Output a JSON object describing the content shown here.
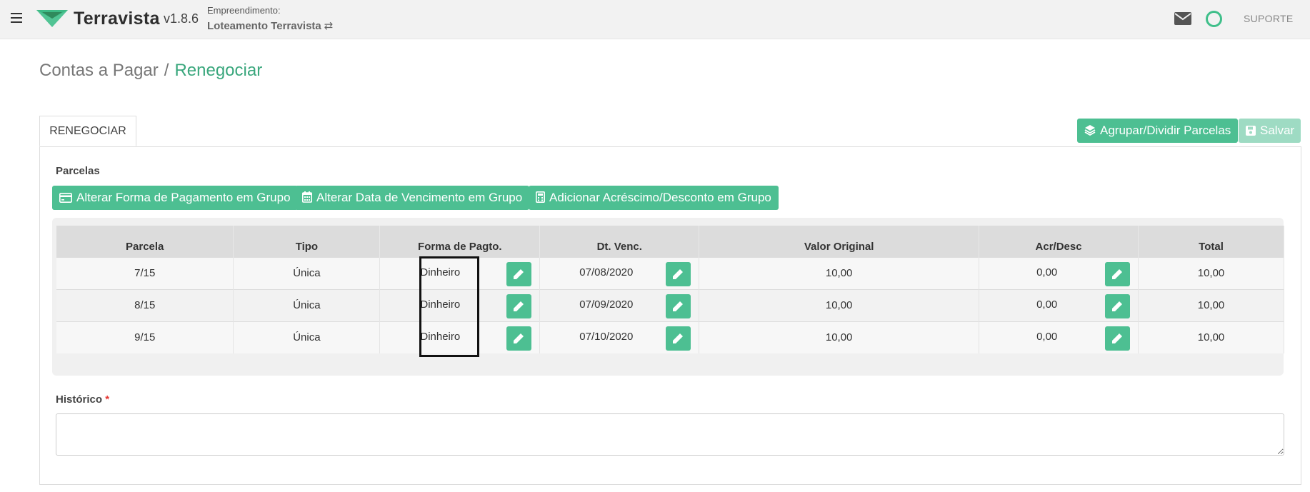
{
  "header": {
    "app_name": "Terravista",
    "version": "v1.8.6",
    "empreendimento_label": "Empreendimento:",
    "empreendimento_name": "Loteamento Terravista",
    "swap_symbol": "⇄",
    "support_label": "SUPORTE",
    "brand_color": "#3fbf8a"
  },
  "breadcrumb": {
    "parent": "Contas a Pagar",
    "separator": "/",
    "current": "Renegociar"
  },
  "tabs": [
    {
      "label": "RENEGOCIAR",
      "active": true
    }
  ],
  "actions": {
    "group_split": "Agrupar/Dividir Parcelas",
    "save": "Salvar"
  },
  "parcelas": {
    "title": "Parcelas",
    "group_buttons": {
      "payment_form": "Alterar Forma de Pagamento em Grupo",
      "due_date": "Alterar Data de Vencimento em Grupo",
      "adjustment": "Adicionar Acréscimo/Desconto em Grupo"
    },
    "columns": [
      "Parcela",
      "Tipo",
      "Forma de Pagto.",
      "Dt. Venc.",
      "Valor Original",
      "Acr/Desc",
      "Total"
    ],
    "rows": [
      {
        "parcela": "7/15",
        "tipo": "Única",
        "forma": "Dinheiro",
        "venc": "07/08/2020",
        "valor": "10,00",
        "acr": "0,00",
        "total": "10,00"
      },
      {
        "parcela": "8/15",
        "tipo": "Única",
        "forma": "Dinheiro",
        "venc": "07/09/2020",
        "valor": "10,00",
        "acr": "0,00",
        "total": "10,00"
      },
      {
        "parcela": "9/15",
        "tipo": "Única",
        "forma": "Dinheiro",
        "venc": "07/10/2020",
        "valor": "10,00",
        "acr": "0,00",
        "total": "10,00"
      }
    ]
  },
  "historico": {
    "label": "Histórico",
    "required_mark": "*",
    "value": ""
  }
}
